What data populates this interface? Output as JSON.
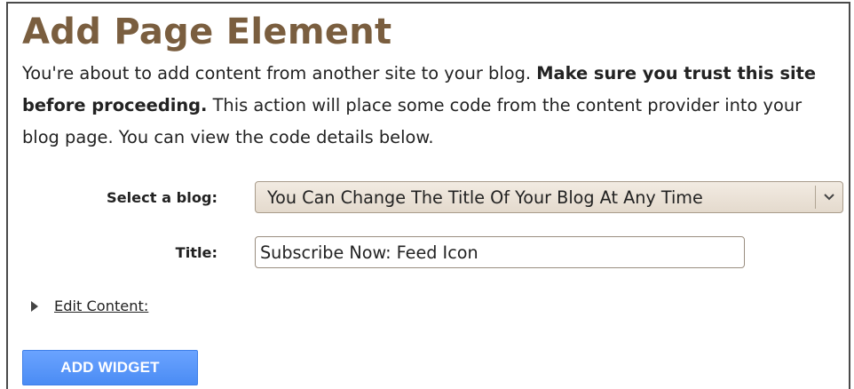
{
  "page_title": "Add Page Element",
  "intro": {
    "part1": "You're about to add content from another site to your blog. ",
    "bold": "Make sure you trust this site before proceeding.",
    "part2": " This action will place some code from the content provider into your blog page. You can view the code details below."
  },
  "form": {
    "blog_label": "Select a blog:",
    "blog_selected": "You Can Change The Title Of Your Blog At Any Time",
    "title_label": "Title:",
    "title_value": "Subscribe Now: Feed Icon"
  },
  "edit_content": {
    "label": "Edit Content:",
    "icon": "disclosure-triangle-right-icon"
  },
  "actions": {
    "add_widget_label": "ADD WIDGET"
  },
  "colors": {
    "title": "#7a5e3f",
    "button": "#4b8cf4",
    "select_bg": "#e9e0d5"
  }
}
